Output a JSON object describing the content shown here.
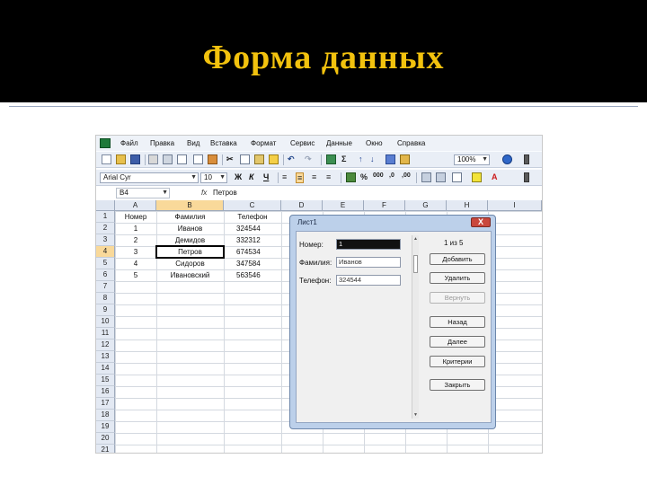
{
  "slide": {
    "title": "Форма данных"
  },
  "menu": [
    "Файл",
    "Правка",
    "Вид",
    "Вставка",
    "Формат",
    "Сервис",
    "Данные",
    "Окно",
    "Справка"
  ],
  "toolbar": {
    "font_name": "Arial Cyr",
    "font_size": "10",
    "zoom": "100%",
    "bold": "Ж",
    "italic": "К",
    "underline": "Ч",
    "sum": "Σ"
  },
  "formula_bar": {
    "name_box": "B4",
    "fx": "fx",
    "value": "Петров"
  },
  "columns": [
    "A",
    "B",
    "C",
    "D",
    "E",
    "F",
    "G",
    "H",
    "I"
  ],
  "rows": [
    "1",
    "2",
    "3",
    "4",
    "5",
    "6",
    "7",
    "8",
    "9",
    "10",
    "11",
    "12",
    "13",
    "14",
    "15",
    "16",
    "17",
    "18",
    "19",
    "20",
    "21"
  ],
  "sheet": {
    "headers": [
      "Номер",
      "Фамилия",
      "Телефон"
    ],
    "data": [
      [
        "1",
        "Иванов",
        "324544"
      ],
      [
        "2",
        "Демидов",
        "332312"
      ],
      [
        "3",
        "Петров",
        "674534"
      ],
      [
        "4",
        "Сидоров",
        "347584"
      ],
      [
        "5",
        "Ивановский",
        "563546"
      ]
    ]
  },
  "dialog": {
    "title": "Лист1",
    "close": "X",
    "counter": "1 из 5",
    "fields": [
      {
        "label": "Номер:",
        "value": "1"
      },
      {
        "label": "Фамилия:",
        "value": "Иванов"
      },
      {
        "label": "Телефон:",
        "value": "324544"
      }
    ],
    "buttons": [
      "Добавить",
      "Удалить",
      "Вернуть",
      "Назад",
      "Далее",
      "Критерии",
      "Закрыть"
    ]
  }
}
